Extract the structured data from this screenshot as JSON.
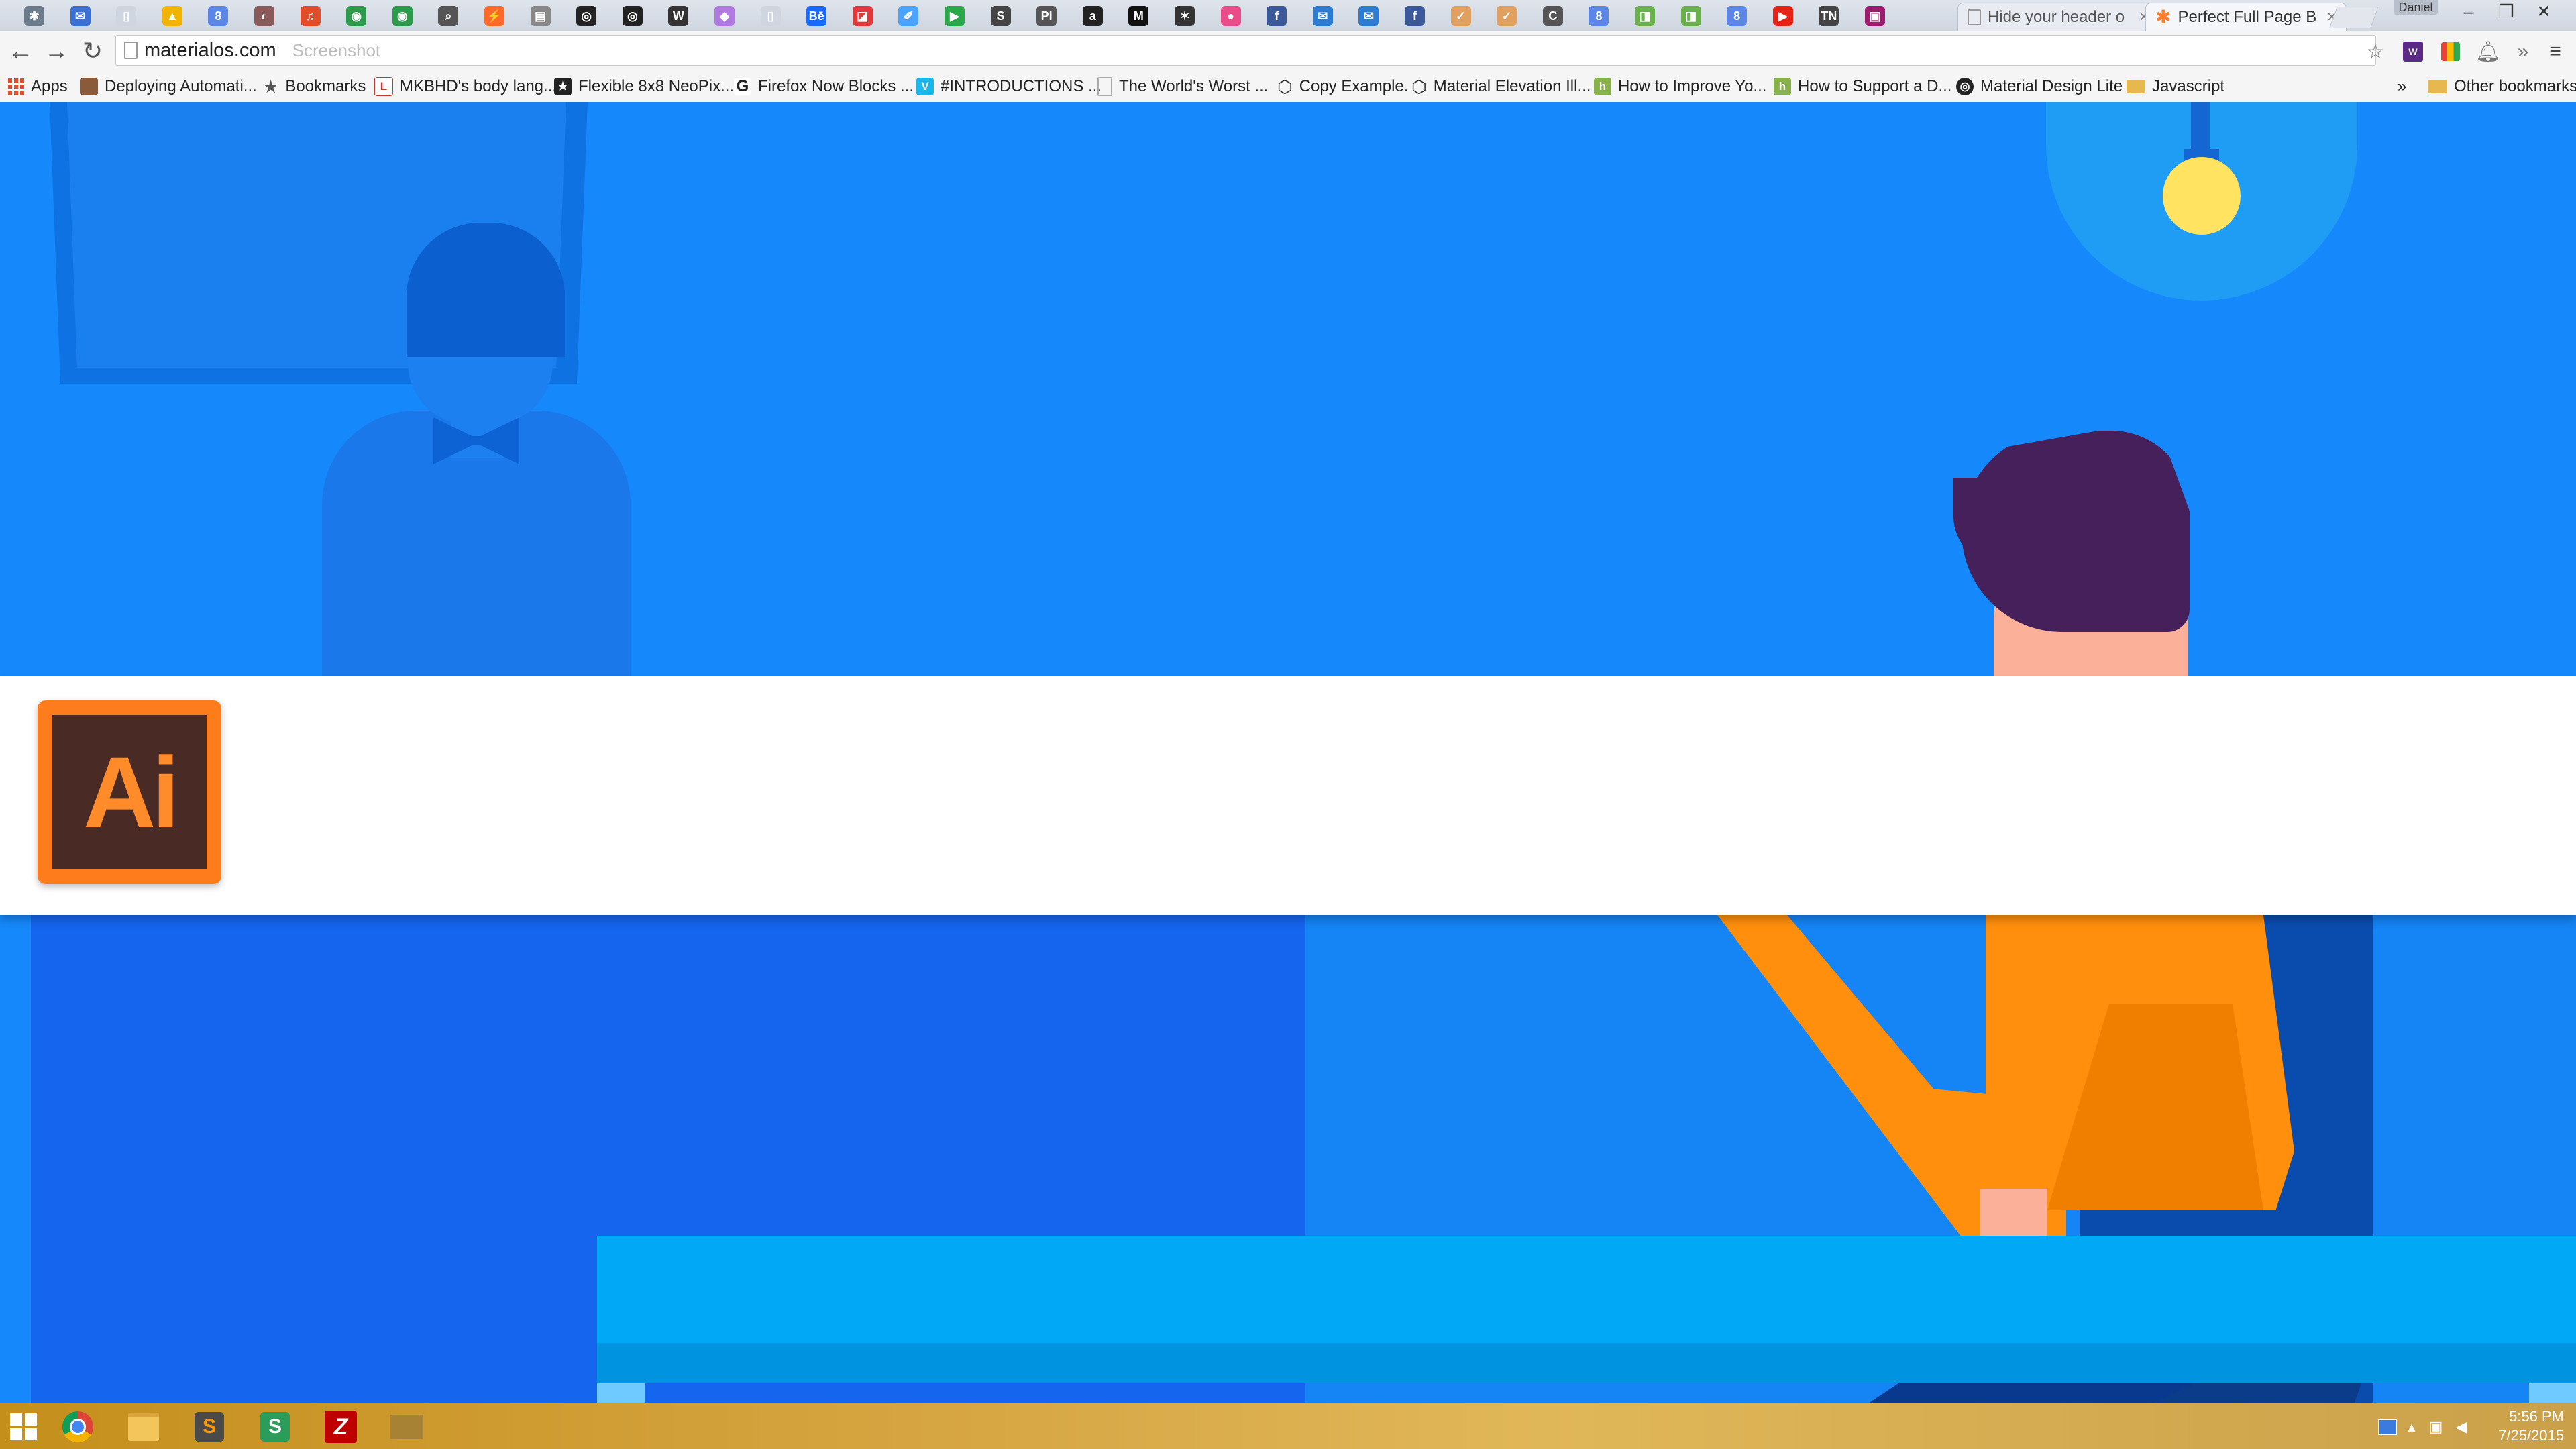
{
  "browser": {
    "user_name": "Daniel",
    "tabs": [
      {
        "title": "Hide your header o",
        "close": "×"
      },
      {
        "title": "Perfect Full Page B",
        "close": "×"
      }
    ],
    "address": "materialos.com",
    "address_ghost": "Screenshot",
    "nav": {
      "back": "←",
      "forward": "→",
      "reload": "↻"
    },
    "window": {
      "minimize": "–",
      "maximize": "❐",
      "close": "✕"
    },
    "toolbar_icons": {
      "star": "☆",
      "more": "»",
      "menu": "≡"
    }
  },
  "pinned_tabs": [
    {
      "glyph": "✱",
      "color": "#6b7b8c"
    },
    {
      "glyph": "✉",
      "color": "#3b6fd1"
    },
    {
      "glyph": "▯",
      "color": "#cfd6e0"
    },
    {
      "glyph": "▲",
      "color": "#f1b400"
    },
    {
      "glyph": "8",
      "color": "#5b86e5"
    },
    {
      "glyph": "◐",
      "color": "#8a5a5a"
    },
    {
      "glyph": "♫",
      "color": "#e04d2a"
    },
    {
      "glyph": "◉",
      "color": "#2b9a4a"
    },
    {
      "glyph": "◉",
      "color": "#2b9a4a"
    },
    {
      "glyph": "⌕",
      "color": "#555555"
    },
    {
      "glyph": "⚡",
      "color": "#ff6a2b"
    },
    {
      "glyph": "▤",
      "color": "#888888"
    },
    {
      "glyph": "◎",
      "color": "#222222"
    },
    {
      "glyph": "◎",
      "color": "#222222"
    },
    {
      "glyph": "W",
      "color": "#333333"
    },
    {
      "glyph": "◆",
      "color": "#b07ae0"
    },
    {
      "glyph": "▯",
      "color": "#cfd6e0"
    },
    {
      "glyph": "Bē",
      "color": "#1769ff"
    },
    {
      "glyph": "◪",
      "color": "#e0383b"
    },
    {
      "glyph": "✐",
      "color": "#4aa3ff"
    },
    {
      "glyph": "▶",
      "color": "#2aa84a"
    },
    {
      "glyph": "S",
      "color": "#444444"
    },
    {
      "glyph": "PI",
      "color": "#555555"
    },
    {
      "glyph": "a",
      "color": "#222222"
    },
    {
      "glyph": "M",
      "color": "#111111"
    },
    {
      "glyph": "✶",
      "color": "#333333"
    },
    {
      "glyph": "●",
      "color": "#ea4c89"
    },
    {
      "glyph": "f",
      "color": "#3b5998"
    },
    {
      "glyph": "✉",
      "color": "#2e7cd1"
    },
    {
      "glyph": "✉",
      "color": "#2e7cd1"
    },
    {
      "glyph": "f",
      "color": "#3b5998"
    },
    {
      "glyph": "✓",
      "color": "#e0a060"
    },
    {
      "glyph": "✓",
      "color": "#e0a060"
    },
    {
      "glyph": "C",
      "color": "#555555"
    },
    {
      "glyph": "8",
      "color": "#5b86e5"
    },
    {
      "glyph": "◨",
      "color": "#6ab04c"
    },
    {
      "glyph": "◨",
      "color": "#6ab04c"
    },
    {
      "glyph": "8",
      "color": "#5b86e5"
    },
    {
      "glyph": "▶",
      "color": "#e62117"
    },
    {
      "glyph": "TN",
      "color": "#444444"
    },
    {
      "glyph": "▣",
      "color": "#9b1b6e"
    }
  ],
  "bookmarks": [
    {
      "label": "Apps",
      "icon": "apps-grid"
    },
    {
      "label": "Deploying Automati...",
      "icon": "avatar",
      "color": "#8a5a3a"
    },
    {
      "label": "Bookmarks",
      "icon": "star",
      "color": "#666666"
    },
    {
      "label": "MKBHD's body lang...",
      "icon": "page",
      "color": "#c0392b"
    },
    {
      "label": "Flexible 8x8 NeoPix...",
      "icon": "star",
      "color": "#222222"
    },
    {
      "label": "Firefox Now Blocks ...",
      "icon": "G",
      "color": "#222222"
    },
    {
      "label": "#INTRODUCTIONS ...",
      "icon": "V",
      "color": "#1ab7ea"
    },
    {
      "label": "The World's Worst ...",
      "icon": "page",
      "color": "#999999"
    },
    {
      "label": "Copy Example.",
      "icon": "codepen",
      "color": "#222222"
    },
    {
      "label": "Material Elevation Ill...",
      "icon": "codepen",
      "color": "#222222"
    },
    {
      "label": "How to Improve Yo...",
      "icon": "h",
      "color": "#88b04b"
    },
    {
      "label": "How to Support a D...",
      "icon": "h",
      "color": "#88b04b"
    },
    {
      "label": "Material Design Lite",
      "icon": "gh",
      "color": "#222222"
    },
    {
      "label": "Javascript",
      "icon": "folder",
      "color": "#e6b84d"
    },
    {
      "label": "»",
      "icon": "none"
    },
    {
      "label": "Other bookmarks",
      "icon": "folder",
      "color": "#e6b84d"
    }
  ],
  "page": {
    "logo_text": "Ai",
    "fab_label": "+"
  },
  "taskbar": {
    "time": "5:56 PM",
    "date": "7/25/2015"
  }
}
